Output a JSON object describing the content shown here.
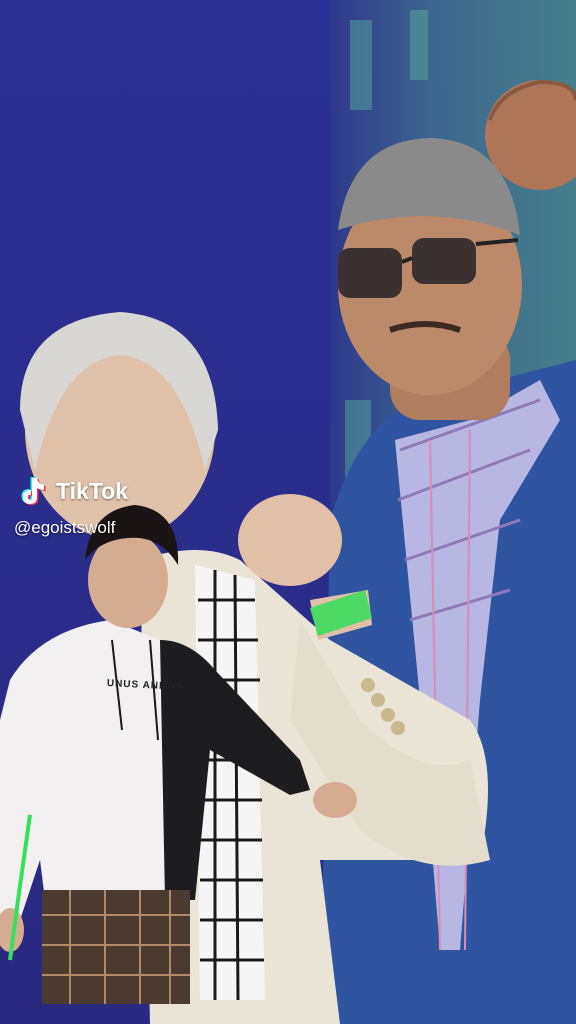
{
  "watermark": {
    "brand": "TikTok",
    "handle": "@egoistswolf",
    "logo_icon": "tiktok-note-icon",
    "colors": {
      "cyan": "#25F4EE",
      "red": "#FE2C55",
      "white": "#FFFFFF"
    }
  },
  "overlay": {
    "hoodie_print": "UNUS ANNUS"
  },
  "colors": {
    "background": "#2B2D8C",
    "blazer": "#2F54A0",
    "jacket_cream": "#E9E4D6",
    "wristband": "#4CD964"
  }
}
